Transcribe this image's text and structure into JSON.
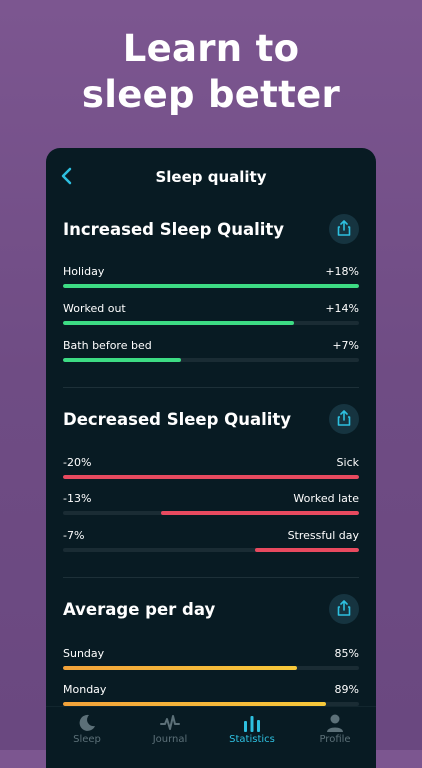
{
  "headline": {
    "line1": "Learn to",
    "line2": "sleep better"
  },
  "screen": {
    "title": "Sleep quality"
  },
  "colors": {
    "green": "#3ddc84",
    "red": "#e84a5f",
    "orange": "#f2a23a",
    "yellow": "#f7c93a",
    "accent": "#2ec0e0"
  },
  "increased": {
    "title": "Increased Sleep Quality",
    "rows": [
      {
        "label": "Holiday",
        "value": "+18%",
        "fraction": 1.0
      },
      {
        "label": "Worked out",
        "value": "+14%",
        "fraction": 0.78
      },
      {
        "label": "Bath before bed",
        "value": "+7%",
        "fraction": 0.4
      }
    ]
  },
  "decreased": {
    "title": "Decreased Sleep Quality",
    "rows": [
      {
        "label": "Sick",
        "value": "-20%",
        "fraction": 1.0
      },
      {
        "label": "Worked late",
        "value": "-13%",
        "fraction": 0.67
      },
      {
        "label": "Stressful day",
        "value": "-7%",
        "fraction": 0.35
      }
    ]
  },
  "average": {
    "title": "Average per day",
    "rows": [
      {
        "label": "Sunday",
        "value": "85%",
        "fraction": 0.79
      },
      {
        "label": "Monday",
        "value": "89%",
        "fraction": 0.89
      }
    ]
  },
  "tabs": [
    {
      "label": "Sleep",
      "icon": "moon-icon",
      "active": false
    },
    {
      "label": "Journal",
      "icon": "pulse-icon",
      "active": false
    },
    {
      "label": "Statistics",
      "icon": "bar-chart-icon",
      "active": true
    },
    {
      "label": "Profile",
      "icon": "person-icon",
      "active": false
    }
  ]
}
